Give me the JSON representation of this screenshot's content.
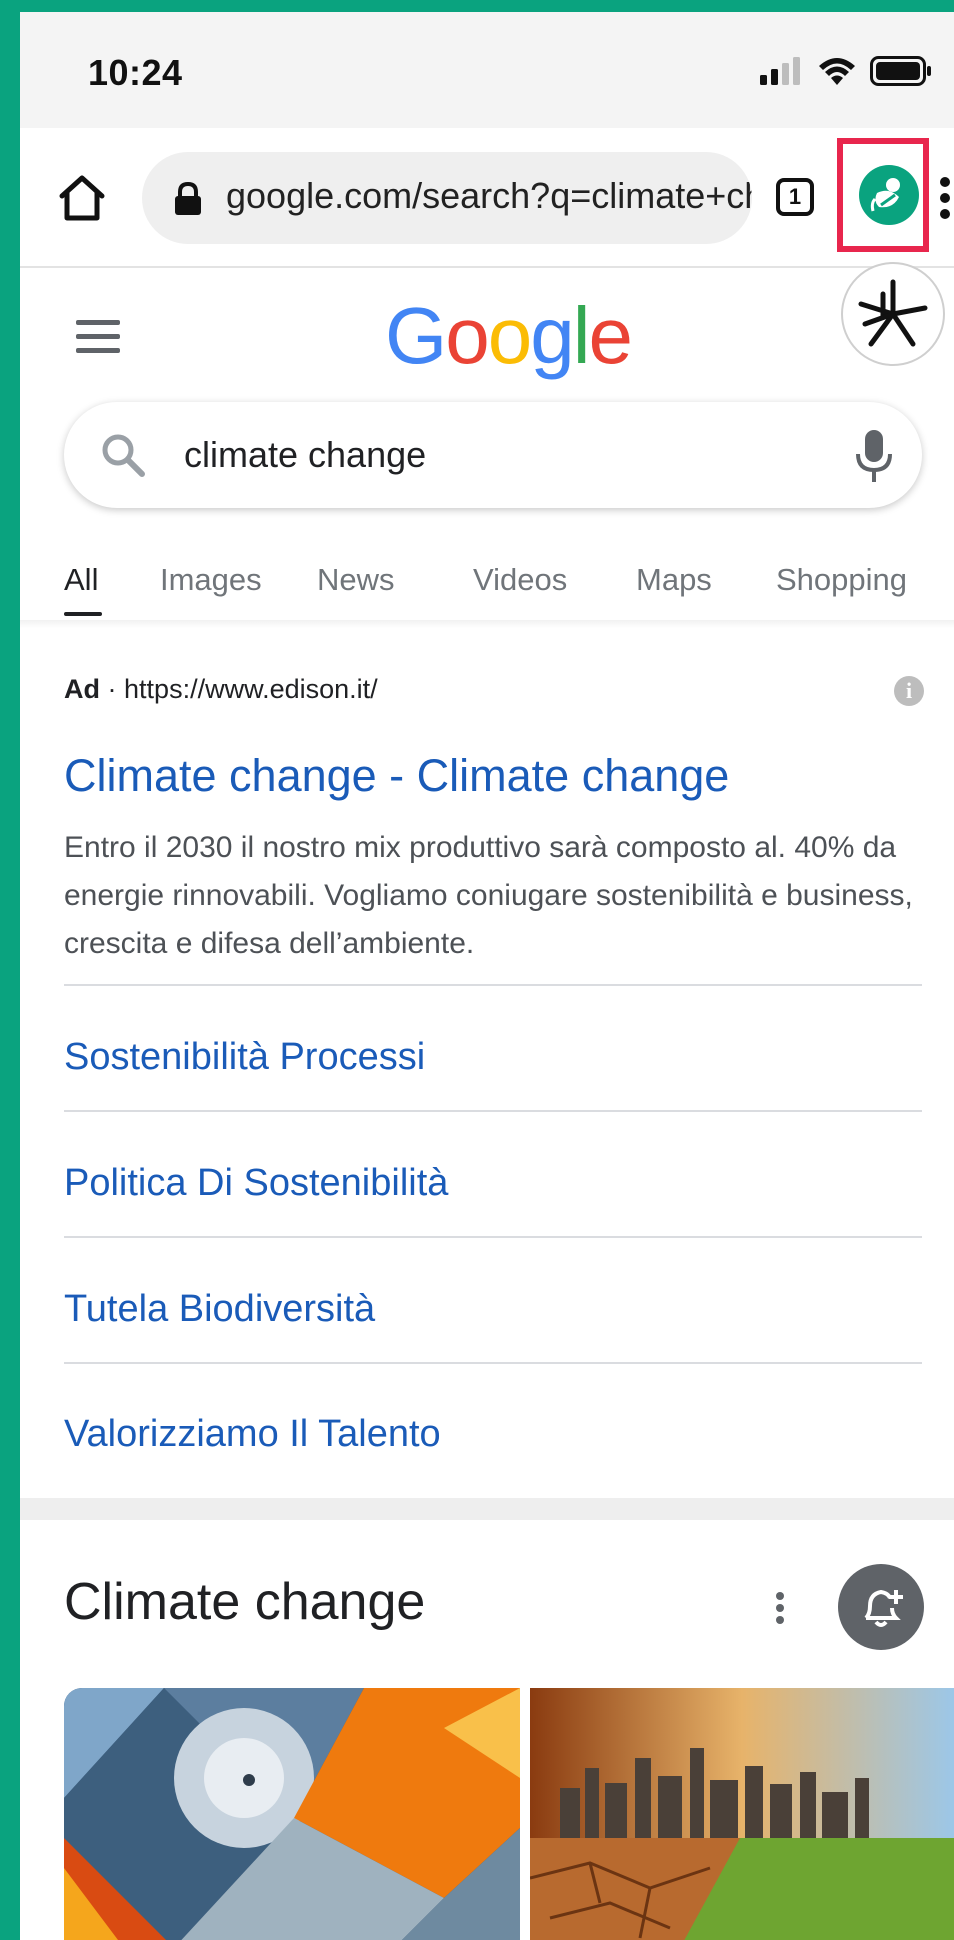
{
  "status_bar": {
    "time": "10:24"
  },
  "browser": {
    "url": "google.com/search?q=climate+change",
    "tab_count": "1"
  },
  "google": {
    "logo": [
      "G",
      "o",
      "o",
      "g",
      "l",
      "e"
    ],
    "logo_colors": [
      "#4285F4",
      "#EA4335",
      "#FBBC05",
      "#4285F4",
      "#34A853",
      "#EA4335"
    ],
    "search_query": "climate change",
    "tabs": [
      "All",
      "Images",
      "News",
      "Videos",
      "Maps",
      "Shopping"
    ],
    "active_tab": "All"
  },
  "ad": {
    "badge": "Ad",
    "separator": "·",
    "url": "https://www.edison.it/",
    "title": "Climate change - Climate change",
    "description": "Entro il 2030 il nostro mix produttivo sarà composto al. 40% da energie rinnovabili. Vogliamo coniugare sostenibilità e business, crescita e difesa dell’ambiente.",
    "sitelinks": [
      "Sostenibilità Processi",
      "Politica Di Sostenibilità",
      "Tutela Biodiversità",
      "Valorizziamo Il Talento"
    ]
  },
  "knowledge_panel": {
    "title": "Climate change"
  },
  "colors": {
    "frame": "#0aa37f",
    "highlight": "#e8264d",
    "link": "#1a5bb8"
  }
}
